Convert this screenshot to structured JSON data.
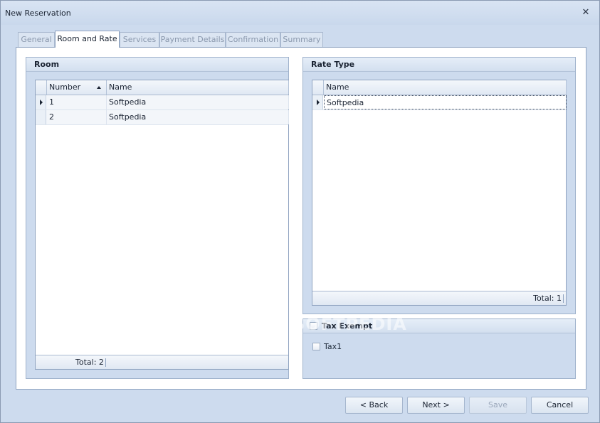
{
  "window": {
    "title": "New Reservation"
  },
  "tabs": [
    {
      "label": "General"
    },
    {
      "label": "Room and Rate"
    },
    {
      "label": "Services"
    },
    {
      "label": "Payment Details"
    },
    {
      "label": "Confirmation"
    },
    {
      "label": "Summary"
    }
  ],
  "active_tab": "Room and Rate",
  "room": {
    "title": "Room",
    "columns": [
      "Number",
      "Name"
    ],
    "rows": [
      {
        "number": "1",
        "name": "Softpedia"
      },
      {
        "number": "2",
        "name": "Softpedia"
      }
    ],
    "total": "Total: 2"
  },
  "rate_type": {
    "title": "Rate Type",
    "columns": [
      "Name"
    ],
    "rows": [
      {
        "name": "Softpedia"
      }
    ],
    "total": "Total: 1"
  },
  "tax": {
    "title": "Tax Exempt",
    "items": [
      {
        "label": "Tax1"
      }
    ]
  },
  "buttons": {
    "back": "< Back",
    "next": "Next >",
    "save": "Save",
    "cancel": "Cancel"
  },
  "watermark": "SOFTPEDIA",
  "icons": {
    "close": "close-icon",
    "sort": "sort-ascending-icon",
    "row_indicator": "row-indicator-icon"
  }
}
